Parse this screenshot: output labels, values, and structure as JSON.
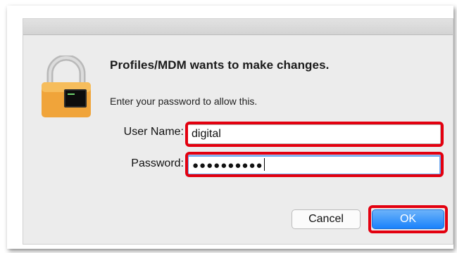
{
  "dialog": {
    "title": "Profiles/MDM wants to make changes.",
    "subtitle": "Enter your password to allow this.",
    "user_label": "User Name:",
    "user_value": "digital",
    "password_label": "Password:",
    "password_value": "●●●●●●●●●●",
    "cancel_label": "Cancel",
    "ok_label": "OK"
  },
  "colors": {
    "highlight": "#e3000f",
    "ok_button": "#1a82fb",
    "lock_body": "#f0a43a"
  }
}
